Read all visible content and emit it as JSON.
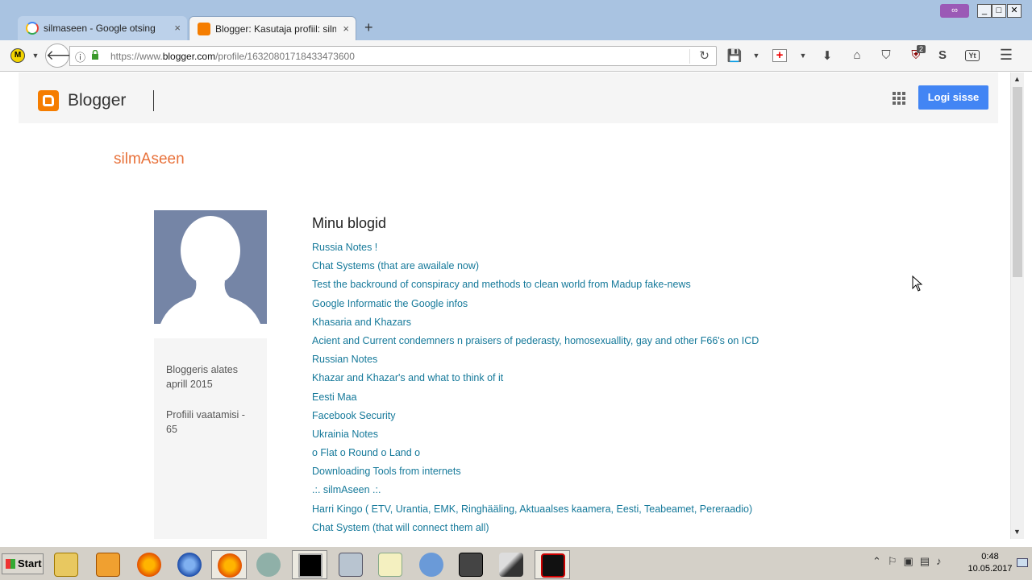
{
  "browser": {
    "tabs": [
      {
        "label": "silmaseen - Google otsing",
        "close": "×"
      },
      {
        "label": "Blogger: Kasutaja profiil: silmAseen",
        "close": "×"
      }
    ],
    "new_tab": "+",
    "window_buttons": {
      "minimize": "_",
      "maximize": "□",
      "close": "✕"
    },
    "url": {
      "prefix": "https://www.",
      "domain": "blogger.com",
      "path": "/profile/16320801718433473600"
    },
    "badges": {
      "ublock_count": "2"
    }
  },
  "page": {
    "brand": "Blogger",
    "login_label": "Logi sisse",
    "profile_name": "silmAseen",
    "since_text": "Bloggeris alates aprill 2015",
    "views_text": "Profiili vaatamisi - 65",
    "blogs_title": "Minu blogid",
    "blogs": [
      "Russia Notes !",
      "Chat Systems (that are awailale now)",
      "Test the backround of conspiracy and methods to clean world from Madup fake-news",
      "Google Informatic the Google infos",
      "Khasaria and Khazars",
      "Acient and Current condemners n praisers of pederasty, homosexuallity, gay and other F66's on ICD",
      "Russian Notes",
      "Khazar and Khazar's and what to think of it",
      "Eesti Maa",
      "Facebook Security",
      "Ukrainia Notes",
      "o Flat o Round o Land o",
      "Downloading Tools from internets",
      ".:. silmAseen .:.",
      "Harri Kingo ( ETV, Urantia, EMK, Ringhääling, Aktuaalses kaamera, Eesti, Teabeamet, Pereraadio)",
      "Chat System (that will connect them all)"
    ]
  },
  "taskbar": {
    "start_label": "Start",
    "time": "0:48",
    "date": "10.05.2017"
  },
  "colors": {
    "blogger_orange": "#f57d00",
    "link": "#15799a",
    "login_blue": "#4285f4",
    "name_orange": "#e8713a"
  }
}
